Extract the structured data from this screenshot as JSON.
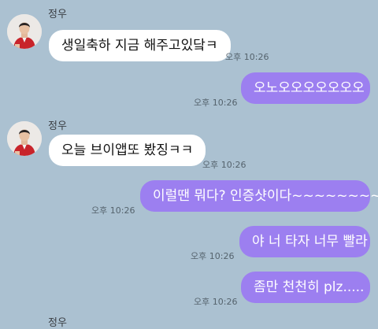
{
  "chat": {
    "contact_name": "정우",
    "messages": [
      {
        "direction": "incoming",
        "sender": "정우",
        "text": "생일축하 지금 해주고있닼ㅋ",
        "time": "오후 10:26"
      },
      {
        "direction": "outgoing",
        "text": "오노오오오오오오오",
        "time": "오후 10:26"
      },
      {
        "direction": "incoming",
        "sender": "정우",
        "text": "오늘 브이앱또 봤징ㅋㅋ",
        "time": "오후 10:26"
      },
      {
        "direction": "outgoing",
        "text": "이럴땐 뭐다? 인증샷이다~~~~~~~~~",
        "time": "오후 10:26"
      },
      {
        "direction": "outgoing",
        "text": "야 너 타자 너무 빨라",
        "time": "오후 10:26"
      },
      {
        "direction": "outgoing",
        "text": "좀만 천천히 plz.....",
        "time": "오후 10:26"
      },
      {
        "direction": "incoming",
        "sender": "정우"
      }
    ]
  },
  "colors": {
    "background": "#abc1d1",
    "outgoing_bubble": "#9c7ff0",
    "incoming_bubble": "#ffffff"
  }
}
